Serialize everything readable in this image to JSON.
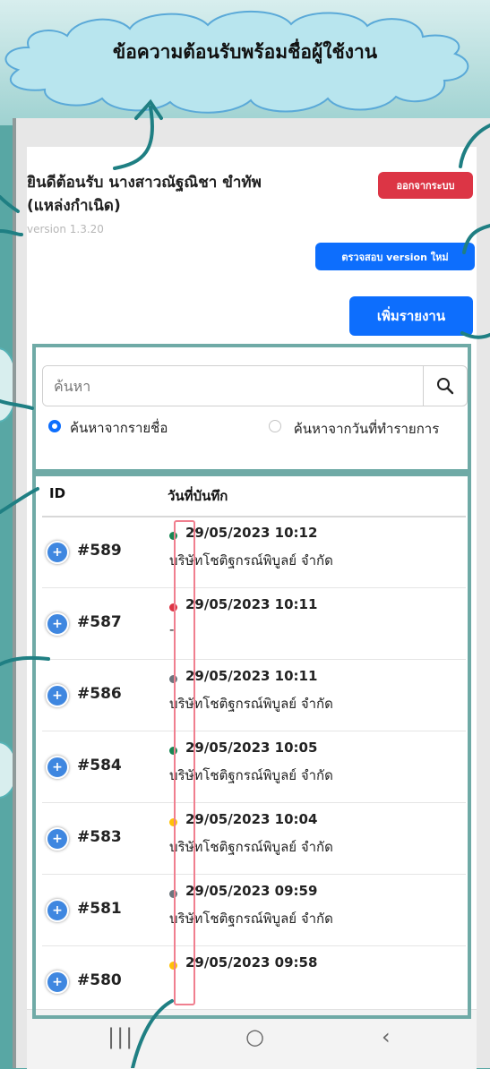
{
  "annotation": {
    "cloud_label": "ข้อความต้อนรับพร้อมชื่อผู้ใช้งาน"
  },
  "header": {
    "welcome_text": "ยินดีต้อนรับ นางสาวณัฐณิชา ขำทัพ (แหล่งกำเนิด)",
    "version": "version 1.3.20",
    "logout_label": "ออกจากระบบ",
    "check_version_label": "ตรวจสอบ version ใหม่",
    "add_report_label": "เพิ่มรายงาน"
  },
  "search": {
    "placeholder": "ค้นหา",
    "icon": "search-icon",
    "options": [
      {
        "label": "ค้นหาจากรายชื่อ",
        "checked": true
      },
      {
        "label": "ค้นหาจากวันที่ทำรายการ",
        "checked": false
      }
    ]
  },
  "table": {
    "columns": [
      "ID",
      "วันที่บันทึก"
    ],
    "rows": [
      {
        "id": "#589",
        "datetime": "29/05/2023 10:12",
        "company": "บริษัทโชติฐกรณ์พิบูลย์ จำกัด",
        "status": "green"
      },
      {
        "id": "#587",
        "datetime": "29/05/2023 10:11",
        "company": "-",
        "status": "red"
      },
      {
        "id": "#586",
        "datetime": "29/05/2023 10:11",
        "company": "บริษัทโชติฐกรณ์พิบูลย์ จำกัด",
        "status": "gray"
      },
      {
        "id": "#584",
        "datetime": "29/05/2023 10:05",
        "company": "บริษัทโชติฐกรณ์พิบูลย์ จำกัด",
        "status": "green"
      },
      {
        "id": "#583",
        "datetime": "29/05/2023 10:04",
        "company": "บริษัทโชติฐกรณ์พิบูลย์ จำกัด",
        "status": "yellow"
      },
      {
        "id": "#581",
        "datetime": "29/05/2023 09:59",
        "company": "บริษัทโชติฐกรณ์พิบูลย์ จำกัด",
        "status": "gray"
      },
      {
        "id": "#580",
        "datetime": "29/05/2023 09:58",
        "company": "",
        "status": "yellow"
      }
    ]
  },
  "nav": {
    "recents": "|||",
    "home": "○",
    "back": "‹"
  },
  "colors": {
    "status_green": "#198754",
    "status_red": "#dc3545",
    "status_gray": "#6c757d",
    "status_yellow": "#ffc107",
    "primary_blue": "#0d6efd",
    "danger_red": "#dc3545",
    "annotation_teal": "#58a7a4"
  }
}
